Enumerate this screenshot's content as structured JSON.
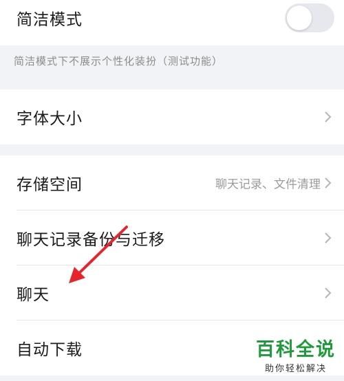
{
  "simple_mode": {
    "label": "简洁模式",
    "toggle_on": false,
    "note": "简洁模式下不展示个性化装扮（测试功能）"
  },
  "settings": {
    "font_size": {
      "label": "字体大小"
    },
    "storage": {
      "label": "存储空间",
      "value": "聊天记录、文件清理"
    },
    "chat_backup": {
      "label": "聊天记录备份与迁移"
    },
    "chat": {
      "label": "聊天"
    },
    "auto_download": {
      "label": "自动下载"
    }
  },
  "icons": {
    "chevron": "chevron-right-icon",
    "annotation": "red-arrow-icon"
  },
  "colors": {
    "background": "#f2f3f6",
    "annotation_arrow": "#e8242b",
    "watermark_green": "#1f9a3a"
  },
  "watermark": {
    "title": "百科全说",
    "subtitle": "助你轻松解决"
  }
}
